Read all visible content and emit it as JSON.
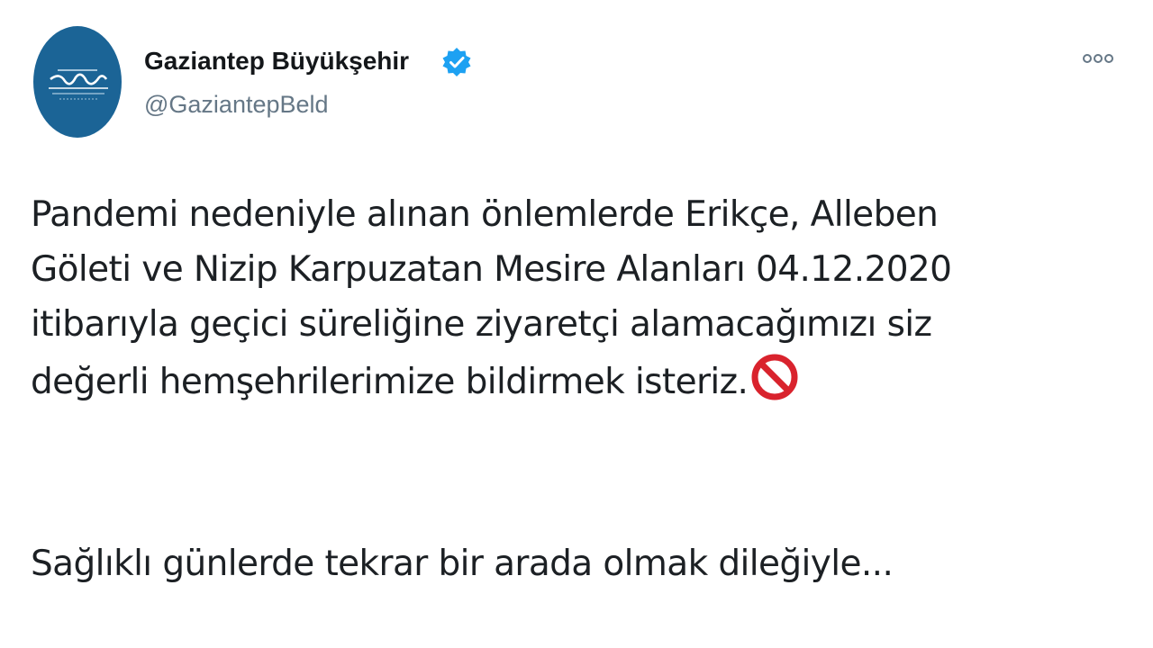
{
  "tweet": {
    "author": {
      "display_name": "Gaziantep Büyükşehir",
      "handle": "@GaziantepBeld",
      "verified": true,
      "avatar_icon": "gaziantep-logo-icon",
      "avatar_color": "#1b6496",
      "verified_color": "#1da1f2"
    },
    "more_icon": "more-options-icon",
    "text": {
      "line1": "Pandemi nedeniyle alınan önlemlerde Erikçe, Alleben",
      "line2": "Göleti ve Nizip Karpuzatan Mesire Alanları 04.12.2020",
      "line3": "itibarıyla geçici süreliğine ziyaretçi alamacağımızı siz",
      "line4": "değerli hemşehrilerimize bildirmek isteriz.",
      "emoji": "no-entry-icon",
      "paragraph2": "Sağlıklı günlerde tekrar bir arada olmak dileğiyle..."
    }
  }
}
